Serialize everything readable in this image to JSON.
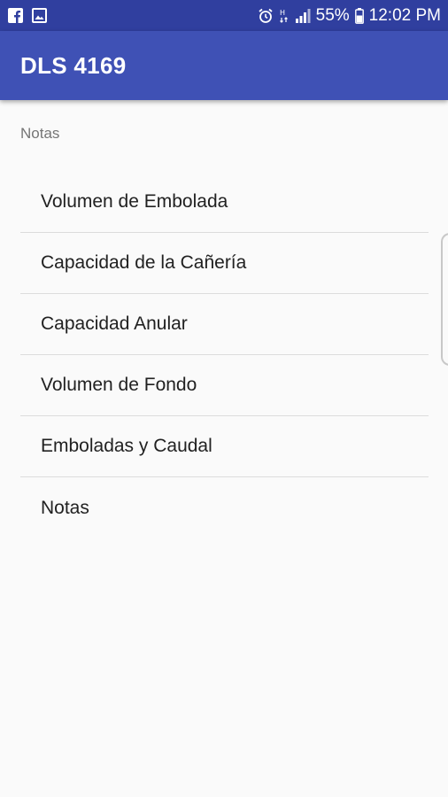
{
  "status_bar": {
    "icons_left": [
      "facebook-icon",
      "image-icon"
    ],
    "icons_right": [
      "alarm-icon",
      "data-icon",
      "signal-icon",
      "battery-icon"
    ],
    "battery": "55%",
    "time": "12:02 PM"
  },
  "app_bar": {
    "title": "DLS 4169"
  },
  "section": {
    "header": "Notas"
  },
  "menu": {
    "items": [
      {
        "label": "Volumen de Embolada"
      },
      {
        "label": "Capacidad de la Cañería"
      },
      {
        "label": "Capacidad Anular"
      },
      {
        "label": "Volumen de Fondo"
      },
      {
        "label": "Emboladas y Caudal"
      },
      {
        "label": "Notas"
      }
    ]
  },
  "colors": {
    "status_bar": "#303f9f",
    "app_bar": "#3f51b5",
    "background": "#fafafa"
  }
}
